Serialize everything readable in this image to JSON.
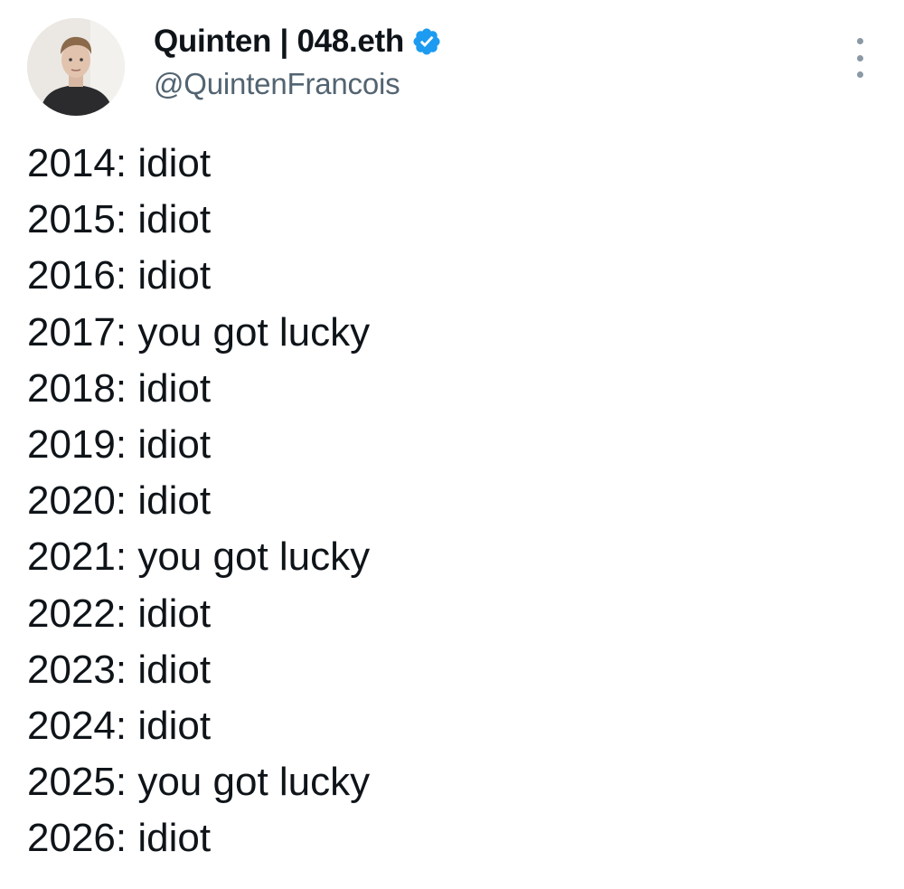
{
  "author": {
    "display_name": "Quinten | 048.eth",
    "handle": "@QuintenFrancois",
    "verified": true,
    "verified_color": "#1d9bf0"
  },
  "more_icon": "more-vertical-icon",
  "tweet": {
    "lines": [
      "2014: idiot",
      "2015: idiot",
      "2016: idiot",
      "2017: you got lucky",
      "2018: idiot",
      "2019: idiot",
      "2020: idiot",
      "2021: you got lucky",
      "2022: idiot",
      "2023: idiot",
      "2024: idiot",
      "2025: you got lucky",
      "2026: idiot"
    ]
  },
  "colors": {
    "text": "#0f1419",
    "secondary_text": "#536471",
    "background": "#ffffff",
    "verified": "#1d9bf0"
  }
}
